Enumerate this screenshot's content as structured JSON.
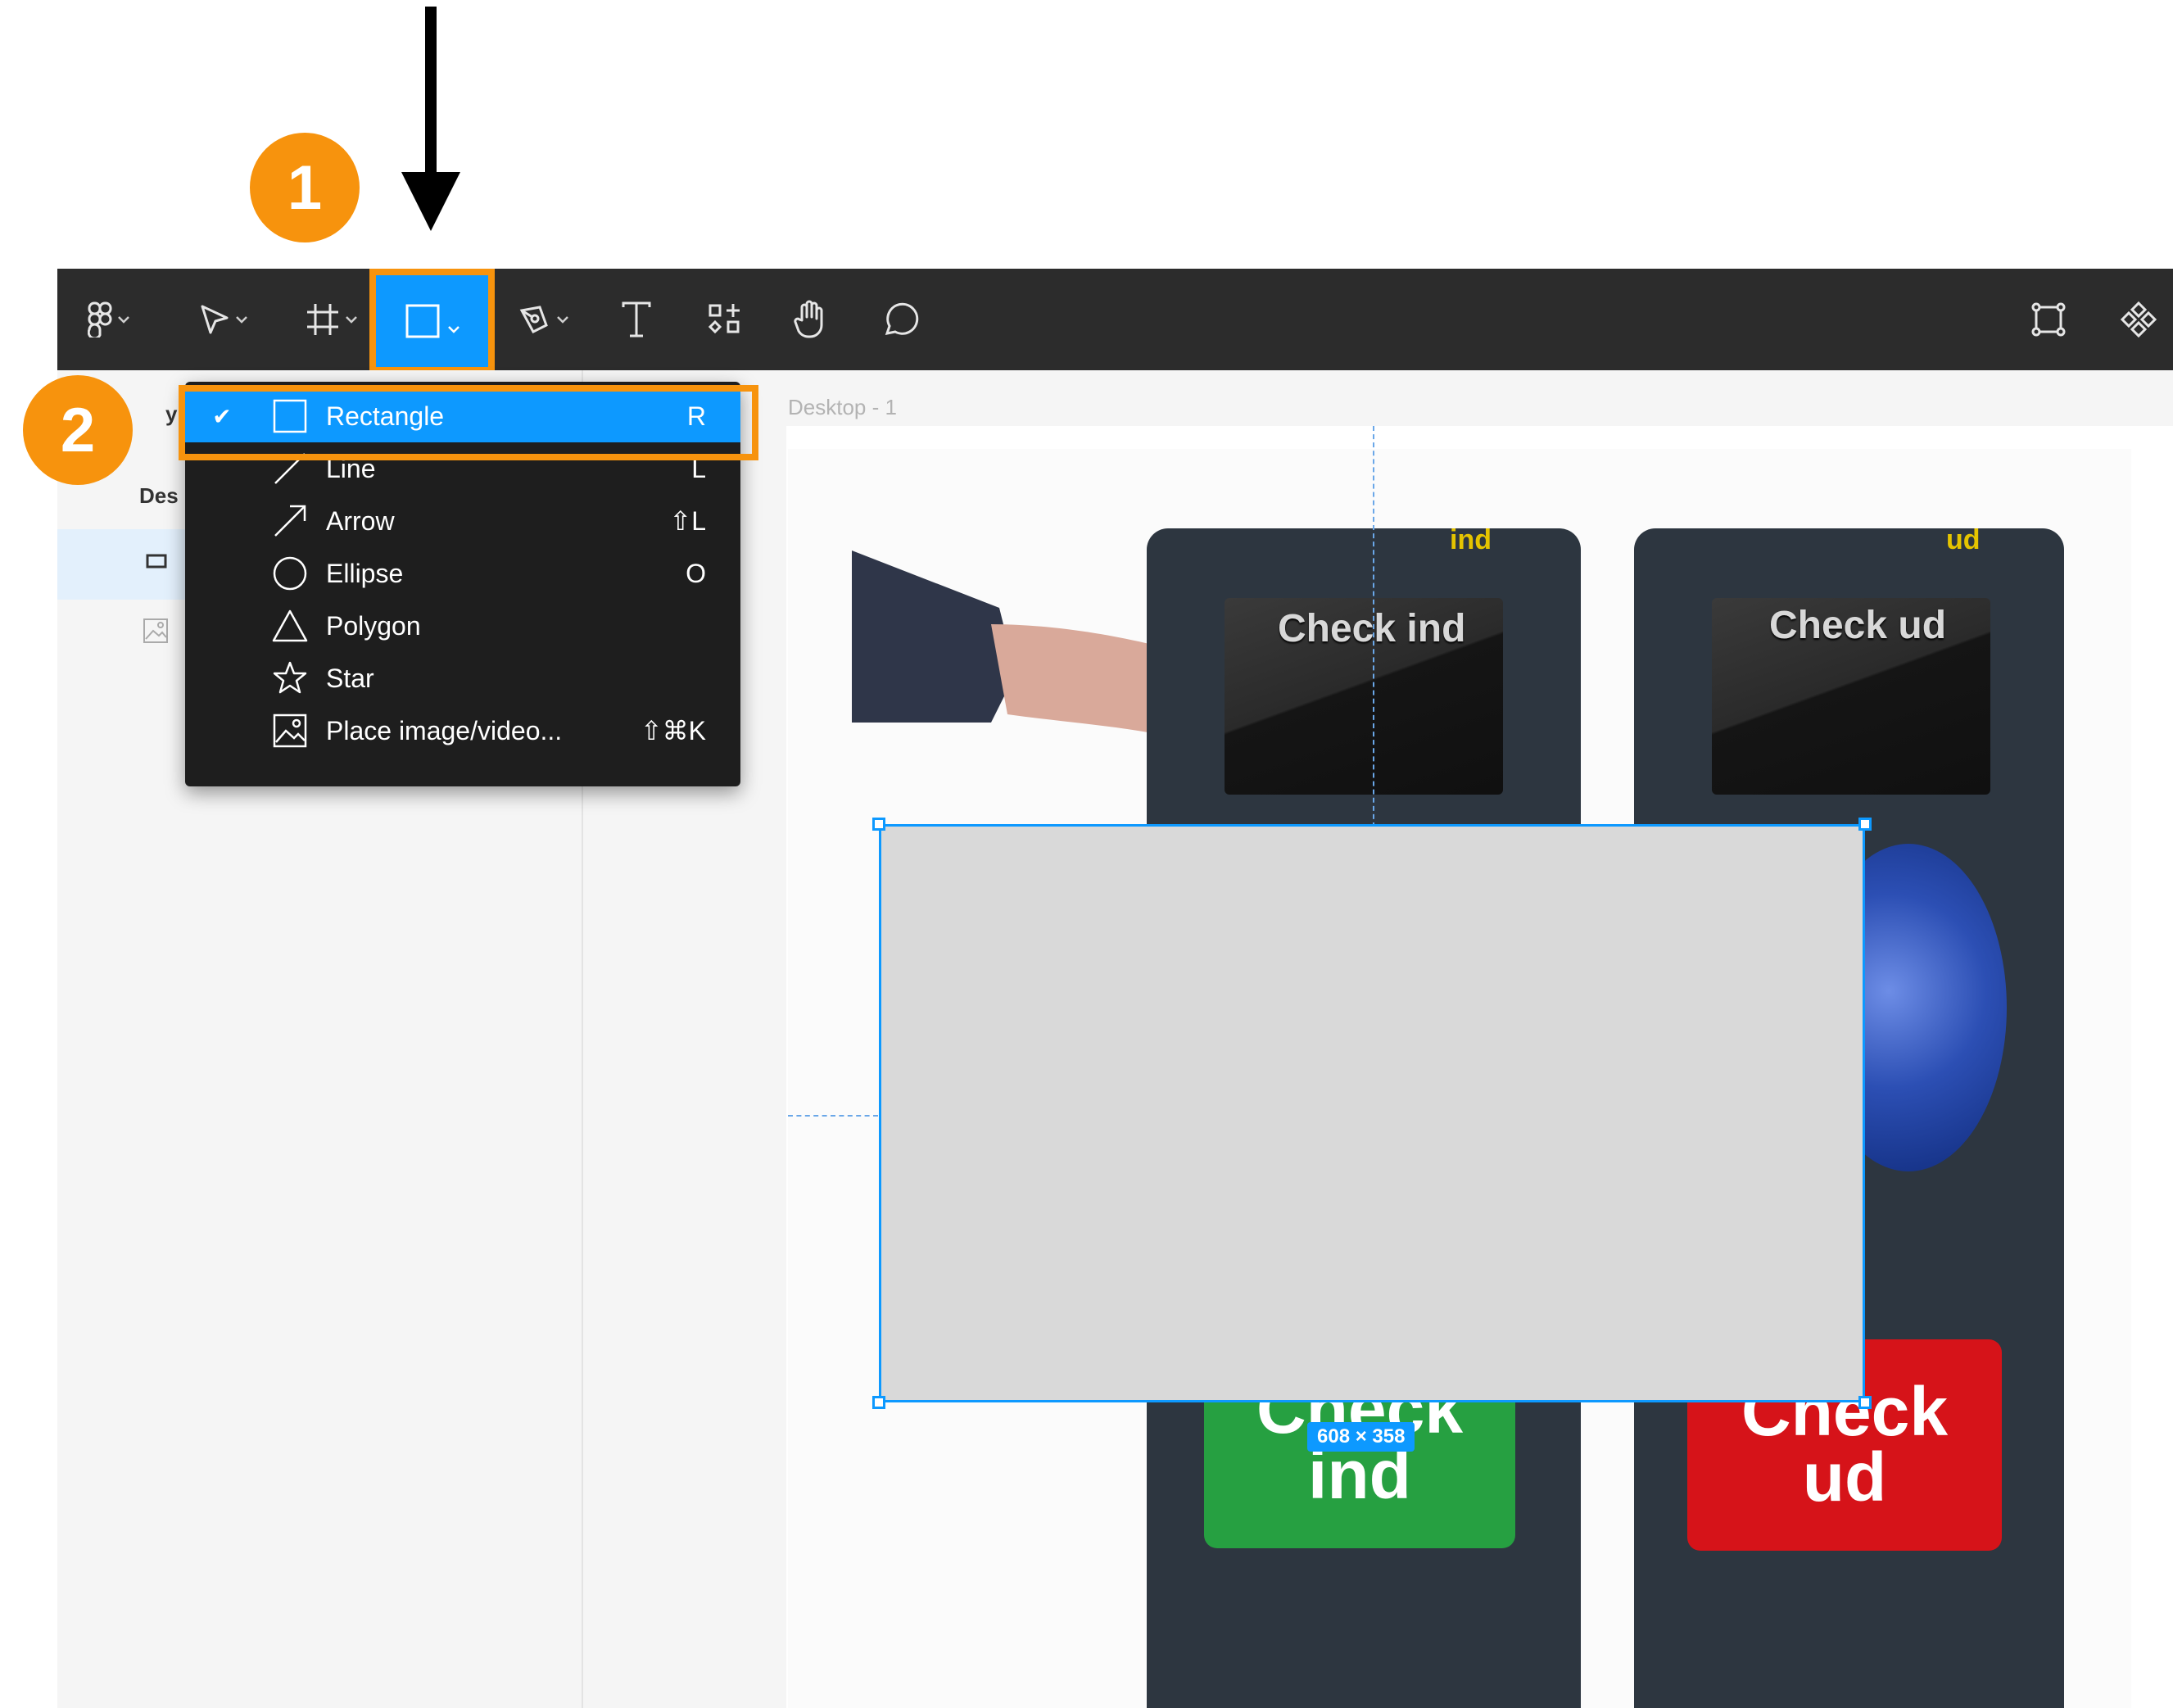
{
  "annotations": {
    "badge1": "1",
    "badge2": "2"
  },
  "toolbar": {
    "tools": [
      {
        "name": "main-menu",
        "icon": "figma-logo-icon"
      },
      {
        "name": "move",
        "icon": "cursor-icon"
      },
      {
        "name": "frame",
        "icon": "hash-frame-icon"
      },
      {
        "name": "shape",
        "icon": "square-icon",
        "active": true
      },
      {
        "name": "pen",
        "icon": "pen-icon"
      },
      {
        "name": "text",
        "icon": "text-icon"
      },
      {
        "name": "resources",
        "icon": "resources-icon"
      },
      {
        "name": "hand",
        "icon": "hand-icon"
      },
      {
        "name": "comment",
        "icon": "comment-icon"
      }
    ],
    "right_tools": [
      {
        "name": "component-set",
        "icon": "component-frame-icon"
      },
      {
        "name": "component",
        "icon": "component-icon"
      }
    ]
  },
  "left_panel": {
    "layers_header_fragment": "y",
    "page_fragment": "Des"
  },
  "canvas": {
    "frame_label": "Desktop - 1",
    "size_label": "608 × 358"
  },
  "illustration": {
    "machine_1": {
      "tag": "ind",
      "screen": "Check ind",
      "button_line1": "Check",
      "button_line2": "ind"
    },
    "machine_2": {
      "tag": "ud",
      "screen": "Check ud",
      "button_line1": "Check",
      "button_line2": "ud"
    }
  },
  "menu": {
    "items": [
      {
        "label": "Rectangle",
        "shortcut": "R",
        "icon": "rectangle-icon",
        "checked": true
      },
      {
        "label": "Line",
        "shortcut": "L",
        "icon": "line-icon"
      },
      {
        "label": "Arrow",
        "shortcut": "⇧L",
        "icon": "arrow-icon"
      },
      {
        "label": "Ellipse",
        "shortcut": "O",
        "icon": "ellipse-icon"
      },
      {
        "label": "Polygon",
        "shortcut": "",
        "icon": "polygon-icon"
      },
      {
        "label": "Star",
        "shortcut": "",
        "icon": "star-icon"
      },
      {
        "label": "Place image/video...",
        "shortcut": "⇧⌘K",
        "icon": "image-icon"
      }
    ],
    "check_mark": "✔"
  },
  "colors": {
    "accent": "#0d99ff",
    "annotation": "#f7930d",
    "toolbar": "#2c2c2c"
  }
}
